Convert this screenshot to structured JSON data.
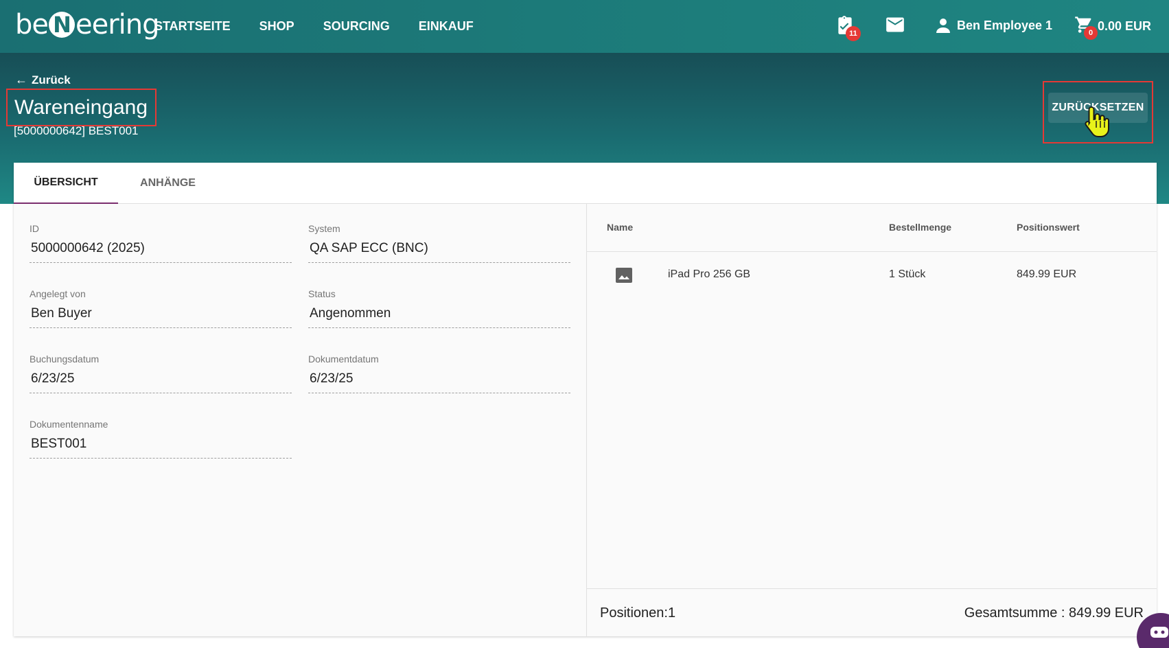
{
  "app": {
    "logo_text_pre": "be",
    "logo_text_n": "N",
    "logo_text_post": "eering"
  },
  "nav": {
    "items": [
      {
        "label": "STARTSEITE"
      },
      {
        "label": "SHOP"
      },
      {
        "label": "SOURCING"
      },
      {
        "label": "EINKAUF"
      }
    ]
  },
  "topbar": {
    "tasks_badge": "11",
    "user_name": "Ben Employee 1",
    "cart_badge": "0",
    "cart_amount": "0.00 EUR"
  },
  "header": {
    "back_label": "Zurück",
    "title": "Wareneingang",
    "subtitle": "[5000000642] BEST001",
    "reset_label": "ZURÜCKSETZEN"
  },
  "tabs": [
    {
      "label": "ÜBERSICHT",
      "active": true
    },
    {
      "label": "ANHÄNGE",
      "active": false
    }
  ],
  "fields": {
    "id": {
      "label": "ID",
      "value": "5000000642 (2025)"
    },
    "system": {
      "label": "System",
      "value": "QA SAP ECC (BNC)"
    },
    "created_by": {
      "label": "Angelegt von",
      "value": "Ben Buyer"
    },
    "status": {
      "label": "Status",
      "value": "Angenommen"
    },
    "posting_date": {
      "label": "Buchungsdatum",
      "value": "6/23/25"
    },
    "document_date": {
      "label": "Dokumentdatum",
      "value": "6/23/25"
    },
    "document_name": {
      "label": "Dokumentenname",
      "value": "BEST001"
    }
  },
  "table": {
    "headers": {
      "name": "Name",
      "quantity": "Bestellmenge",
      "value": "Positionswert"
    },
    "rows": [
      {
        "name": "iPad Pro 256 GB",
        "quantity": "1 Stück",
        "value": "849.99 EUR"
      }
    ],
    "footer_positions": "Positionen:1",
    "footer_total": "Gesamtsumme : 849.99 EUR"
  },
  "colors": {
    "brand_teal": "#1d7d7b",
    "highlight_red": "#e53935",
    "tab_active": "#7b2d6e",
    "chat_purple": "#5a2a6b"
  }
}
